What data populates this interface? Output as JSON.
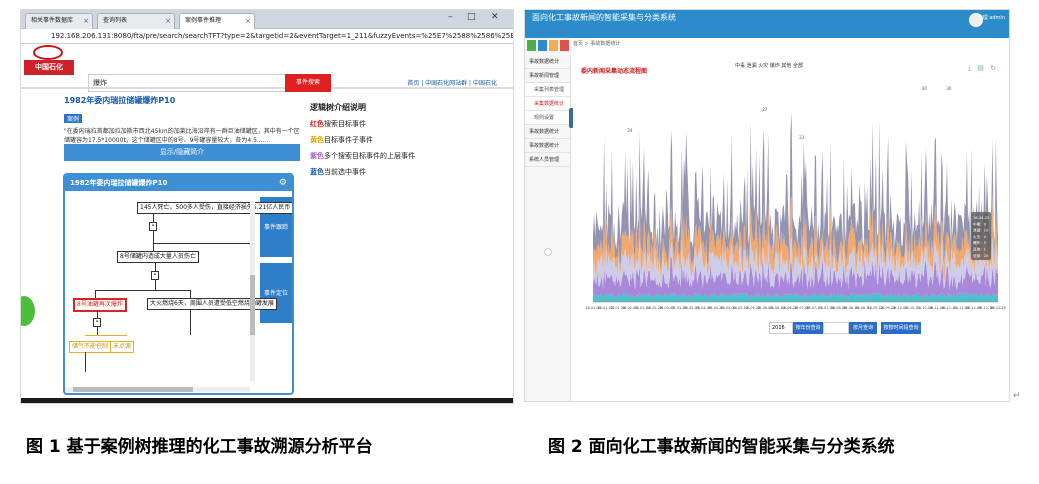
{
  "figure1": {
    "tabs": [
      {
        "label": "相关事件数据库",
        "active": false
      },
      {
        "label": "查询列表",
        "active": false
      },
      {
        "label": "案例事件推理",
        "active": true
      }
    ],
    "url": "192.168.206.131:8080/fta/pre/search/searchTFT?type=2&targetid=2&eventTarget=1_211&fuzzyEvents=%25E7%2588%2586%25E7%2582%25B8",
    "logo_text": "中国石化",
    "search_value": "爆炸",
    "search_button": "事件搜索",
    "top_links": "首页 | 中国石化网站群 | 中国石化",
    "result": {
      "title": "1982年委内瑞拉储罐爆炸P10",
      "tag": "案例",
      "text": "\"在委内瑞拉首都加拉加斯市西北45km的加莱比海沿岸有一群巨油储罐区，其中有一个区储罐容为17.5*10000t，这个储罐区中的8号、9号罐容量较大，各为4.5......",
      "expand_button": "显示/隐藏简介"
    },
    "legend": {
      "title": "逻辑树介绍说明",
      "items": [
        {
          "color": "#d62020",
          "name": "红色",
          "desc": "搜索目标事件"
        },
        {
          "color": "#e0a800",
          "name": "黄色",
          "desc": "目标事件子事件"
        },
        {
          "color": "#b060d0",
          "name": "紫色",
          "desc": "多个搜索目标事件的上层事件"
        },
        {
          "color": "#1a5aa8",
          "name": "蓝色",
          "desc": "当前选中事件"
        }
      ]
    },
    "tree": {
      "title": "1982年委内瑞拉储罐爆炸P10",
      "side_buttons": [
        "事件跟踪",
        "事件定位"
      ],
      "nodes": {
        "top": "145人死亡，500多人受伤，直接经济损失5.21亿人民币",
        "mid": "8号储罐内造成大量人员伤亡",
        "right": "大火燃烧6天，周围人员遭受低空燃烧油罐发展",
        "red": "8号油罐再次爆炸",
        "yel1": "储气不能控制",
        "yel2": "未点源"
      },
      "gate_symbol": "•"
    }
  },
  "figure2": {
    "title": "面向化工事故新闻的智能采集与分类系统",
    "user": "管理\nadmin",
    "sidebar": [
      {
        "label": "事故数据统计",
        "level": 0
      },
      {
        "label": "事故新闻管理",
        "level": 0
      },
      {
        "label": "采集列表管理",
        "level": 1
      },
      {
        "label": "采集数据统计",
        "level": 1
      },
      {
        "label": "规则设置",
        "level": 1
      },
      {
        "label": "事故数据统计",
        "level": 0
      },
      {
        "label": "事故数据统计",
        "level": 0
      },
      {
        "label": "系统人员管理",
        "level": 0
      }
    ],
    "breadcrumb": "首页 > 事故数据统计",
    "chart_title": "委内新闻采集动态流程图",
    "legend": "中毒  泄漏  火灾  爆炸  其他  全部",
    "year_value": "2016",
    "buttons": [
      "按年份查询",
      "按月查询",
      "按按时间段查询"
    ],
    "tooltip": [
      "16-04-25",
      "中毒：0",
      "泄漏：10",
      "火灾：4",
      "爆炸：5",
      "其他：1",
      "全部：20"
    ]
  },
  "chart_data": {
    "type": "area",
    "title": "委内新闻采集动态流程图",
    "stacked": true,
    "series_names": [
      "中毒",
      "泄漏",
      "火灾",
      "爆炸",
      "其他",
      "全部"
    ],
    "series_colors": [
      "#3ab8c8",
      "#a07ad6",
      "#c8c8e6",
      "#f0a060",
      "#8888a8",
      "#9aa4bc"
    ],
    "x_ticks": [
      "16-01-01",
      "16-01-12",
      "16-01-23",
      "16-02-03",
      "16-02-14",
      "16-02-25",
      "16-03-07",
      "16-03-18",
      "16-03-29",
      "16-04-09",
      "16-04-20",
      "16-05-01",
      "16-05-12",
      "16-05-23",
      "16-06-03",
      "16-06-14",
      "16-06-25",
      "16-07-06",
      "16-07-17",
      "16-07-28",
      "16-08-08",
      "16-08-19",
      "16-08-30",
      "16-09-10",
      "16-09-21",
      "16-10-02",
      "16-10-13",
      "16-10-24",
      "16-11-04",
      "16-11-15",
      "16-11-26",
      "16-12-07",
      "16-12-18",
      "16-12-29"
    ],
    "peak_labels": [
      {
        "x": "16-02-03",
        "value": 24
      },
      {
        "x": "16-06-03",
        "value": 27
      },
      {
        "x": "16-07-06",
        "value": 23
      },
      {
        "x": "16-10-24",
        "value": 30
      },
      {
        "x": "16-11-15",
        "value": 30
      }
    ],
    "year": 2016
  },
  "captions": {
    "fig1": "图 1  基于案例树推理的化工事故溯源分析平台",
    "fig2": "图 2  面向化工事故新闻的智能采集与分类系统"
  },
  "return_mark": "↵"
}
